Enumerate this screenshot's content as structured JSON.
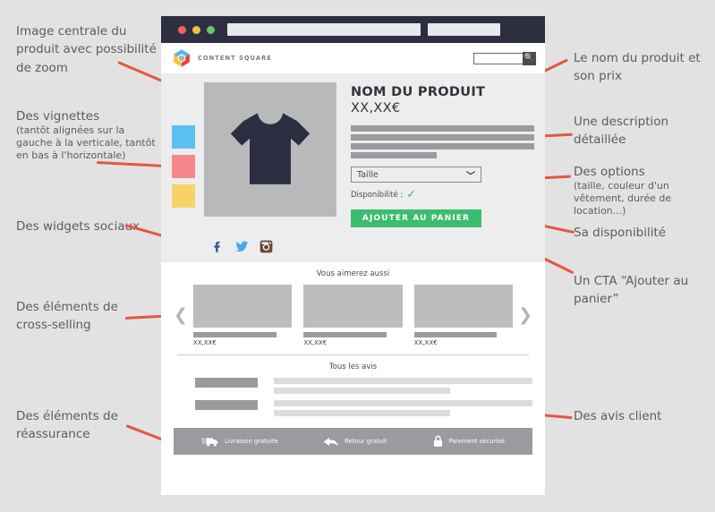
{
  "annotations": {
    "left": [
      {
        "title": "Image centrale du produit avec possibilité de zoom",
        "sub": ""
      },
      {
        "title": "Des vignettes",
        "sub": "(tantôt alignées sur la gauche à la verticale, tantôt en bas à l'horizontale)"
      },
      {
        "title": "Des widgets sociaux",
        "sub": ""
      },
      {
        "title": "Des éléments de cross-selling",
        "sub": ""
      },
      {
        "title": "Des éléments de réassurance",
        "sub": ""
      }
    ],
    "right": [
      {
        "title": "Le nom du produit et son prix",
        "sub": ""
      },
      {
        "title": "Une description détaillée",
        "sub": ""
      },
      {
        "title": "Des options",
        "sub": "(taille, couleur d'un vêtement, durée de location...)"
      },
      {
        "title": "Sa disponibilité",
        "sub": ""
      },
      {
        "title": "Un CTA “Ajouter au panier”",
        "sub": ""
      },
      {
        "title": "Des avis client",
        "sub": ""
      }
    ]
  },
  "browser": {
    "dots": [
      "red",
      "yellow",
      "green"
    ],
    "url_value": "",
    "tab_value": ""
  },
  "site_header": {
    "brand": "CONTENT SQUARE",
    "search_value": "",
    "search_placeholder": "",
    "search_icon": "search-icon"
  },
  "product": {
    "name": "NOM DU PRODUIT",
    "price": "XX,XX€",
    "description_bars": [
      100,
      100,
      100,
      47
    ],
    "option_label": "Taille",
    "option_chevron": "chevron-down-icon",
    "availability_label": "Disponibilité :",
    "availability_icon": "check-icon",
    "cta_label": "AJOUTER AU PANIER",
    "thumbnails": [
      {
        "name": "thumbnail-blue",
        "color": "#5bc0f0"
      },
      {
        "name": "thumbnail-pink",
        "color": "#f4888c"
      },
      {
        "name": "thumbnail-yellow",
        "color": "#f7d269"
      }
    ],
    "hero_image_alt": "tshirt-image",
    "hero_bg": "#b9b9bc",
    "tshirt_color": "#2a2e40"
  },
  "social": [
    {
      "name": "facebook-icon",
      "glyph": "f",
      "color": "#3b5998"
    },
    {
      "name": "twitter-icon",
      "glyph": "",
      "color": "#4aa8e8"
    },
    {
      "name": "instagram-icon",
      "glyph": "",
      "color": "#6b4a33"
    }
  ],
  "cross_selling": {
    "title": "Vous aimerez aussi",
    "prev_arrow": "chevron-left-icon",
    "next_arrow": "chevron-right-icon",
    "cards": [
      {
        "price": "XX,XX€"
      },
      {
        "price": "XX,XX€"
      },
      {
        "price": "XX,XX€"
      }
    ]
  },
  "reviews": {
    "title": "Tous les avis",
    "rows": [
      {
        "lines": [
          100,
          68
        ]
      },
      {
        "lines": [
          100,
          68
        ]
      }
    ]
  },
  "reassurance": [
    {
      "icon": "truck-icon",
      "label": "Livraison gratuite"
    },
    {
      "icon": "return-arrow-icon",
      "label": "Retour gratuit"
    },
    {
      "icon": "lock-icon",
      "label": "Paiement sécurisé"
    }
  ],
  "colors": {
    "accent": "#e2583f",
    "cta_green": "#3bbd6e",
    "chrome_dark": "#2d2f40",
    "page_bg": "#e2e2e2"
  }
}
